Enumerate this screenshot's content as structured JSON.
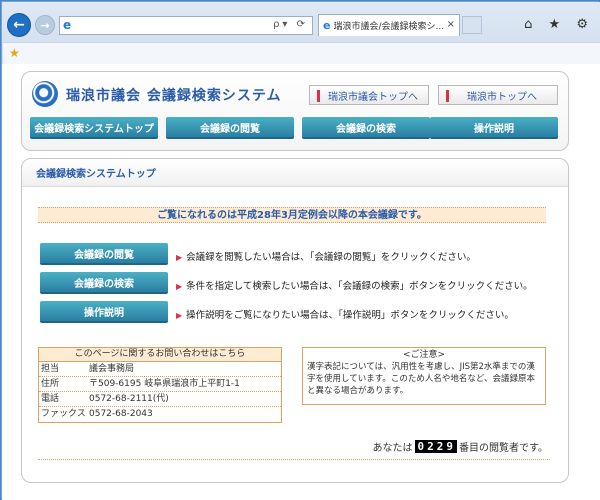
{
  "browser": {
    "tab_title": "瑞浪市議会/会議録検索シ...",
    "address_value": "",
    "tab_close": "×",
    "address_tools": "ρ▾ ⟳",
    "window_icons": "⌂ ★ ⚙"
  },
  "header": {
    "site_title": "瑞浪市議会  会議録検索システム",
    "links": [
      {
        "label": "瑞浪市議会トップへ"
      },
      {
        "label": "瑞浪市トップへ"
      }
    ],
    "nav": [
      {
        "label": "会議録検索システムトップ"
      },
      {
        "label": "会議録の閲覧"
      },
      {
        "label": "会議録の検索"
      },
      {
        "label": "操作説明"
      }
    ]
  },
  "content": {
    "title": "会議録検索システムトップ",
    "notice": "ご覧になれるのは平成28年3月定例会以降の本会議録です。",
    "actions": [
      {
        "label": "会議録の閲覧",
        "desc": "会議録を閲覧したい場合は、「会議録の閲覧」をクリックください。"
      },
      {
        "label": "会議録の検索",
        "desc": "条件を指定して検索したい場合は、「会議録の検索」ボタンをクリックください。"
      },
      {
        "label": "操作説明",
        "desc": "操作説明をご覧になりたい場合は、「操作説明」ボタンをクリックください。"
      }
    ],
    "contact": {
      "heading": "このページに関するお問い合わせはこちら",
      "rows": [
        {
          "label": "担当",
          "value": "議会事務局"
        },
        {
          "label": "住所",
          "value": "〒509-6195  岐阜県瑞浪市上平町1-1"
        },
        {
          "label": "電話",
          "value": "0572-68-2111(代)"
        },
        {
          "label": "ファックス",
          "value": "0572-68-2043"
        }
      ]
    },
    "caution": {
      "heading": "<ご注意>",
      "text": "漢字表記については、汎用性を考慮し、JIS第2水準までの漢字を使用しています。このため人名や地名など、会議録原本と異なる場合があります。"
    },
    "counter": {
      "prefix": "あなたは",
      "digits": [
        "0",
        "2",
        "2",
        "9"
      ],
      "suffix": "番目の閲覧者です。"
    }
  }
}
